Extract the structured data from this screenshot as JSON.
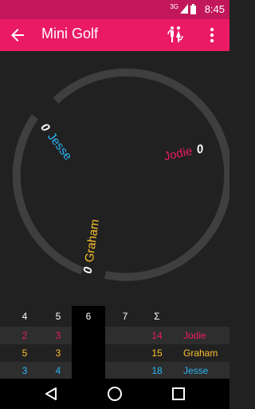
{
  "status_bar": {
    "network": "3G",
    "time": "8:45"
  },
  "app_bar": {
    "title": "Mini Golf",
    "icons": [
      "back-arrow-icon",
      "wc-restroom-icon",
      "overflow-menu-icon"
    ]
  },
  "players": [
    {
      "name": "Jesse",
      "score": "0",
      "color": "#29b6f6"
    },
    {
      "name": "Jodie",
      "score": "0",
      "color": "#ea1a64"
    },
    {
      "name": "Graham",
      "score": "0",
      "color": "#fbc02d"
    }
  ],
  "scorecard": {
    "headers": [
      "4",
      "5",
      "6",
      "7",
      "Σ"
    ],
    "current_hole": "6",
    "rows": [
      {
        "cells": [
          "2",
          "3",
          "",
          "",
          "14"
        ],
        "name": "Jodie",
        "color": "#ea1a64"
      },
      {
        "cells": [
          "5",
          "3",
          "",
          "",
          "15"
        ],
        "name": "Graham",
        "color": "#fbc02d"
      },
      {
        "cells": [
          "3",
          "4",
          "",
          "",
          "18"
        ],
        "name": "Jesse",
        "color": "#29b6f6"
      }
    ]
  },
  "nav_bar": {
    "icons": [
      "back-triangle-icon",
      "home-circle-icon",
      "recents-square-icon"
    ]
  },
  "colors": {
    "primary": "#ea1a64",
    "primary_dark": "#c2185b",
    "background": "#212121",
    "ring": "#3f3f3f"
  }
}
